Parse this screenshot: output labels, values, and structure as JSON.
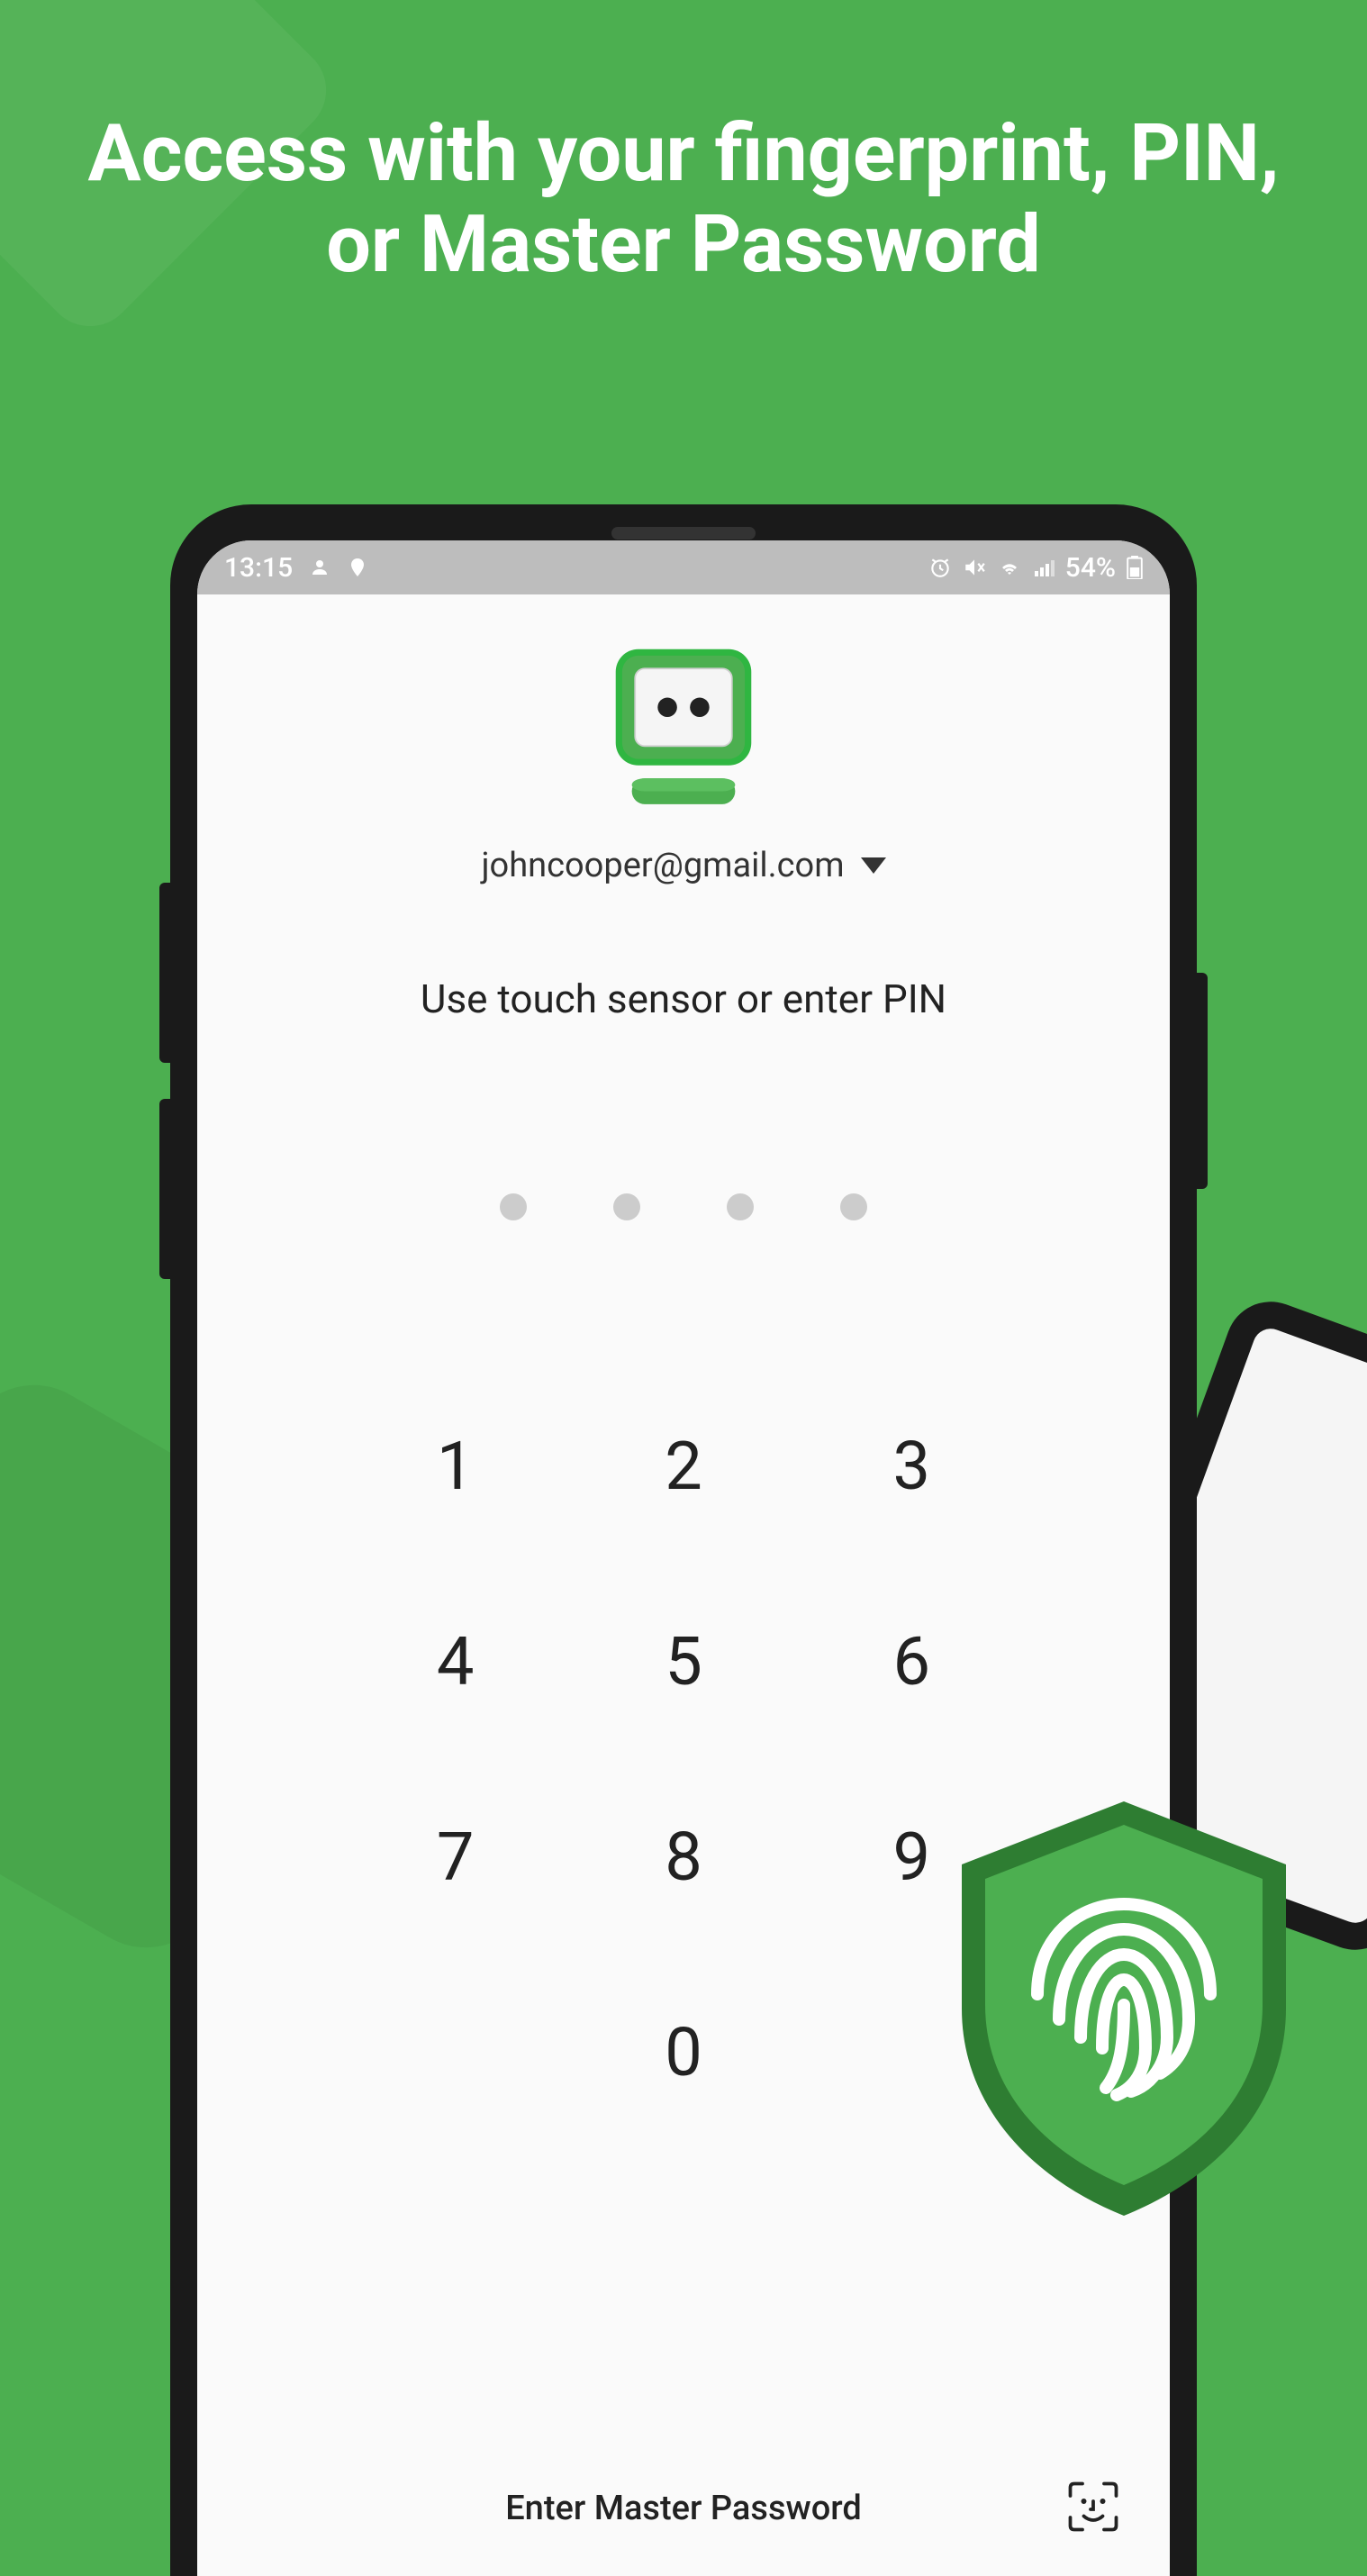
{
  "marketing": {
    "headline": "Access with your fingerprint, PIN, or Master Password"
  },
  "statusBar": {
    "time": "13:15",
    "battery": "54%"
  },
  "app": {
    "accountEmail": "johncooper@gmail.com",
    "instruction": "Use touch sensor or enter PIN",
    "pinLength": 4,
    "keypad": [
      "1",
      "2",
      "3",
      "4",
      "5",
      "6",
      "7",
      "8",
      "9",
      "0"
    ],
    "masterPasswordLabel": "Enter Master Password"
  },
  "icons": {
    "logo": "roboform-logo",
    "chevronDown": "chevron-down-icon",
    "faceId": "face-id-icon",
    "fingerprint": "fingerprint-icon",
    "shield": "shield-icon"
  },
  "colors": {
    "primary": "#4CAF50",
    "primaryDark": "#388E3C",
    "background": "#fafafa"
  }
}
